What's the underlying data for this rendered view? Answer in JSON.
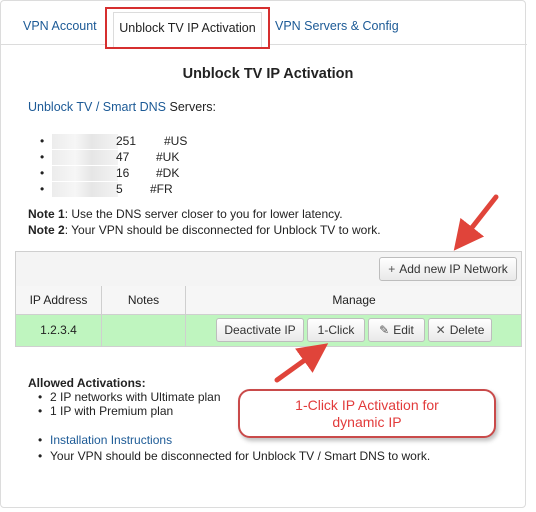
{
  "tabs": [
    {
      "label": "VPN Account"
    },
    {
      "label": "Unblock TV IP Activation"
    },
    {
      "label": "VPN Servers & Config"
    }
  ],
  "page_title": "Unblock TV IP Activation",
  "servers_intro": {
    "link": "Unblock TV / Smart DNS",
    "text": " Servers:"
  },
  "servers": [
    {
      "suffix": "251",
      "tag": "#US"
    },
    {
      "suffix": "47",
      "tag": "#UK"
    },
    {
      "suffix": "16",
      "tag": "#DK"
    },
    {
      "suffix": "5",
      "tag": "#FR"
    }
  ],
  "notes": [
    {
      "label": "Note 1",
      "text": ": Use the DNS server closer to you for lower latency."
    },
    {
      "label": "Note 2",
      "text": ": Your VPN should be disconnected for Unblock TV to work."
    }
  ],
  "grid": {
    "add_button": "Add new IP Network",
    "headers": [
      "IP Address",
      "Notes",
      "Manage"
    ],
    "row": {
      "ip": "1.2.3.4",
      "notes": "",
      "actions": {
        "deactivate": "Deactivate IP",
        "one_click": "1-Click",
        "edit": "Edit",
        "delete": "Delete"
      }
    }
  },
  "allowed": {
    "title": "Allowed Activations:",
    "items": [
      "2 IP networks with Ultimate plan",
      "1 IP with Premium plan"
    ]
  },
  "info": {
    "link": "Installation Instructions",
    "text": "Your VPN should be disconnected for Unblock TV / Smart DNS to work."
  },
  "callout": {
    "line1": "1-Click IP Activation for",
    "line2": "dynamic IP"
  },
  "colors": {
    "link": "#1c5a96",
    "highlight_box": "#d62f2f",
    "active_row": "#bff5bf",
    "callout_text": "#e23b3b"
  }
}
